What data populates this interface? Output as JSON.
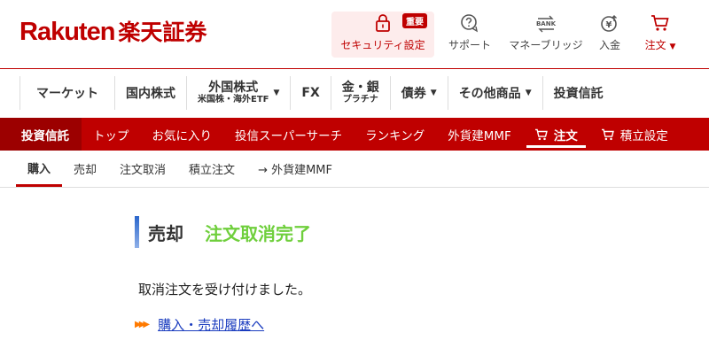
{
  "header": {
    "logo_en": "Rakuten",
    "logo_jp": "楽天証券",
    "utilities": [
      {
        "label": "セキュリティ設定",
        "icon": "lock-icon",
        "badge": "重要"
      },
      {
        "label": "サポート",
        "icon": "support-chat-icon"
      },
      {
        "label": "マネーブリッジ",
        "icon": "bank-transfer-icon",
        "icon_text": "BANK"
      },
      {
        "label": "入金",
        "icon": "deposit-icon"
      },
      {
        "label": "注文",
        "icon": "cart-icon",
        "caret": "▼"
      }
    ]
  },
  "category_nav": [
    {
      "label": "マーケット"
    },
    {
      "label": "国内株式"
    },
    {
      "label": "外国株式",
      "sub": "米国株・海外ETF",
      "caret": "▼"
    },
    {
      "label": "FX"
    },
    {
      "label": "金・銀",
      "sub": "プラチナ"
    },
    {
      "label": "債券",
      "caret": "▼"
    },
    {
      "label": "その他商品",
      "caret": "▼"
    },
    {
      "label": "投資信託"
    }
  ],
  "sub_nav": {
    "section": "投資信託",
    "items": [
      "トップ",
      "お気に入り",
      "投信スーパーサーチ",
      "ランキング",
      "外貨建MMF",
      "注文",
      "積立設定"
    ]
  },
  "tabs": [
    "購入",
    "売却",
    "注文取消",
    "積立注文",
    "→ 外貨建MMF"
  ],
  "content": {
    "title": "売却",
    "status": "注文取消完了",
    "message": "取消注文を受け付けました。",
    "link": "購入・売却履歴へ"
  },
  "colors": {
    "brand": "#bf0000",
    "status": "#6fcf3c",
    "link": "#1a3cbf"
  }
}
